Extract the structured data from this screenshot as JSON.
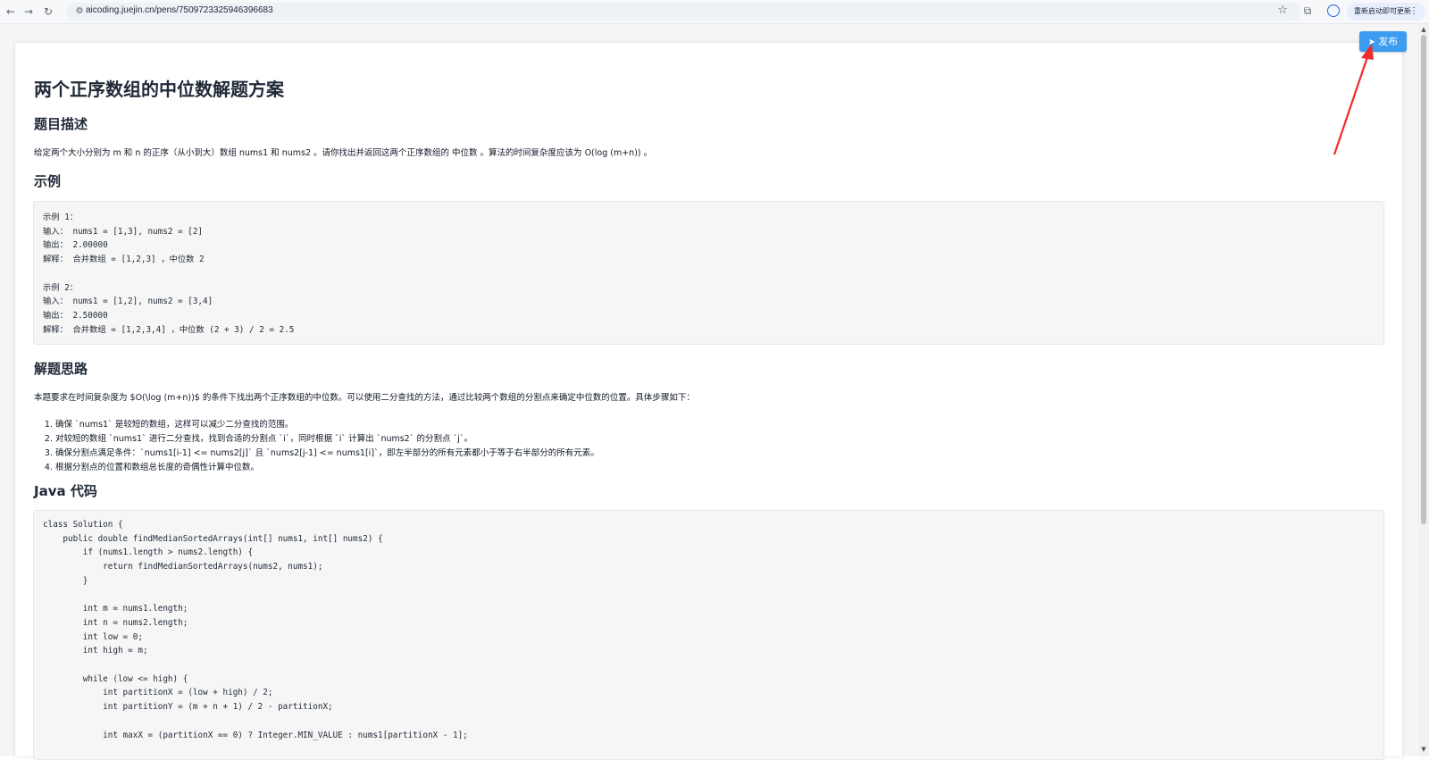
{
  "browser": {
    "url": "aicoding.juejin.cn/pens/7509723325946396683",
    "update_label": "重新启动即可更新",
    "kebab": "⋮"
  },
  "icons": {
    "back": "←",
    "forward": "→",
    "reload": "↻",
    "site_info": "⚙",
    "star": "☆",
    "extensions": "⧉",
    "publish_plane": "➤",
    "scroll_up": "▲",
    "scroll_down": "▼"
  },
  "toolbar": {
    "publish_label": "发布"
  },
  "annotation": {
    "arrow_color": "#ef2b2b"
  },
  "article": {
    "title": "两个正序数组的中位数解题方案",
    "sections": {
      "description": {
        "heading": "题目描述",
        "text": "给定两个大小分别为  m  和  n  的正序（从小到大）数组  nums1  和  nums2 。请你找出并返回这两个正序数组的  中位数 。算法的时间复杂度应该为  O(log (m+n)) 。"
      },
      "examples": {
        "heading": "示例",
        "lines": [
          "示例 1：",
          "输入： nums1 = [1,3], nums2 = [2]",
          "输出： 2.00000",
          "解释： 合并数组 = [1,2,3] ，中位数 2",
          "",
          "示例 2：",
          "输入： nums1 = [1,2], nums2 = [3,4]",
          "输出： 2.50000",
          "解释： 合并数组 = [1,2,3,4] ，中位数 (2 + 3) / 2 = 2.5"
        ]
      },
      "approach": {
        "heading": "解题思路",
        "intro": "本题要求在时间复杂度为 $O(\\log (m+n))$ 的条件下找出两个正序数组的中位数。可以使用二分查找的方法，通过比较两个数组的分割点来确定中位数的位置。具体步骤如下：",
        "steps": [
          "确保 `nums1` 是较短的数组，这样可以减少二分查找的范围。",
          "对较短的数组 `nums1` 进行二分查找，找到合适的分割点 `i`，同时根据 `i` 计算出 `nums2` 的分割点 `j`。",
          "确保分割点满足条件：`nums1[i-1] <= nums2[j]` 且 `nums2[j-1] <= nums1[i]`，即左半部分的所有元素都小于等于右半部分的所有元素。",
          "根据分割点的位置和数组总长度的奇偶性计算中位数。"
        ]
      },
      "code": {
        "heading": "Java 代码",
        "lines": [
          "class Solution {",
          "    public double findMedianSortedArrays(int[] nums1, int[] nums2) {",
          "        if (nums1.length > nums2.length) {",
          "            return findMedianSortedArrays(nums2, nums1);",
          "        }",
          "",
          "        int m = nums1.length;",
          "        int n = nums2.length;",
          "        int low = 0;",
          "        int high = m;",
          "",
          "        while (low <= high) {",
          "            int partitionX = (low + high) / 2;",
          "            int partitionY = (m + n + 1) / 2 - partitionX;",
          "",
          "            int maxX = (partitionX == 0) ? Integer.MIN_VALUE : nums1[partitionX - 1];"
        ]
      }
    }
  }
}
